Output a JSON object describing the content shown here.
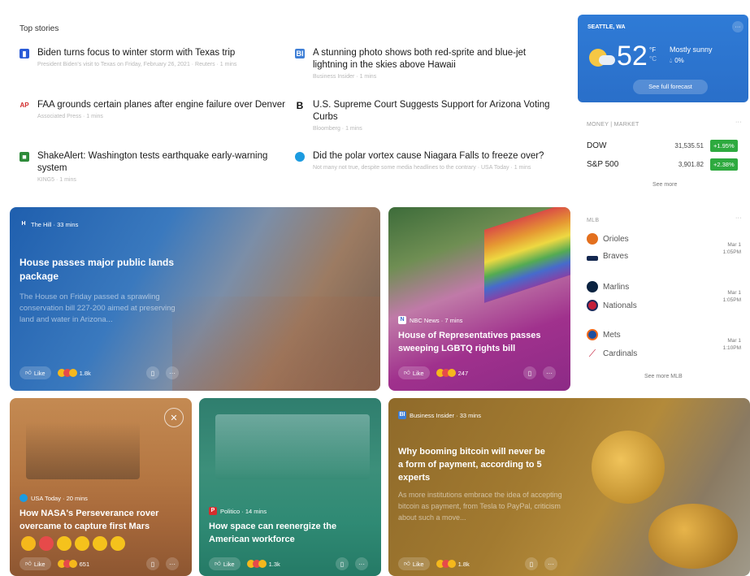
{
  "top_stories": {
    "title": "Top stories",
    "items": [
      {
        "headline": "Biden turns focus to winter storm with Texas trip",
        "meta": "President Biden's visit to Texas on Friday, February 26, 2021 · Reuters · 1 mins",
        "icon": "reuters-icon",
        "color": "#2a5bd7"
      },
      {
        "headline": "A stunning photo shows both red-sprite and blue-jet lightning in the skies above Hawaii",
        "meta": "Business Insider · 1 mins",
        "icon": "business-insider-icon",
        "color": "#3f7fd6"
      },
      {
        "headline": "FAA grounds certain planes after engine failure over Denver",
        "meta": "Associated Press · 1 mins",
        "icon": "ap-icon",
        "color": "#d22d2d"
      },
      {
        "headline": "U.S. Supreme Court Suggests Support for Arizona Voting Curbs",
        "meta": "Bloomberg · 1 mins",
        "icon": "bloomberg-icon",
        "color": "#111111"
      },
      {
        "headline": "ShakeAlert: Washington tests earthquake early-warning system",
        "meta": "KING5 · 1 mins",
        "icon": "king5-icon",
        "color": "#2e8b3a"
      },
      {
        "headline": "Did the polar vortex cause Niagara Falls to freeze over?",
        "meta": "Not many not true, despite some media headlines to the contrary · USA Today · 1 mins",
        "icon": "usa-today-icon",
        "color": "#1c9be0"
      }
    ]
  },
  "cards": [
    {
      "source": "The Hill · 33 mins",
      "logo": "H",
      "title": "House passes major public lands package",
      "desc": "The House on Friday passed a sprawling conservation bill 227-200 aimed at preserving land and water in Arizona...",
      "reactions": "1.8k",
      "like": "Like"
    },
    {
      "source": "NBC News · 7 mins",
      "logo": "N",
      "title": "House of Representatives passes sweeping LGBTQ rights bill",
      "desc": "",
      "reactions": "247",
      "like": "Like"
    },
    {
      "source": "USA Today · 20 mins",
      "logo": "U",
      "title": "How NASA's Perseverance rover overcame to capture first Mars",
      "desc": "",
      "reactions": "651",
      "like": "Like"
    },
    {
      "source": "Politico · 14 mins",
      "logo": "P",
      "title": "How space can reenergize the American workforce",
      "desc": "",
      "reactions": "1.3k",
      "like": "Like"
    },
    {
      "source": "Business Insider · 33 mins",
      "logo": "BI",
      "title": "Why booming bitcoin will never be a form of payment, according to 5 experts",
      "desc": "As more institutions embrace the idea of accepting bitcoin as payment, from Tesla to PayPal, criticism about such a move...",
      "reactions": "1.8k",
      "like": "Like"
    }
  ],
  "weather": {
    "location": "SEATTLE, WA",
    "temp": "52",
    "unit_f": "°F",
    "unit_c": "°C",
    "condition": "Mostly sunny",
    "precip": "0%",
    "forecast_button": "See full forecast",
    "more": "···"
  },
  "market": {
    "title": "MONEY | MARKET",
    "more": "···",
    "rows": [
      {
        "name": "DOW",
        "value": "31,535.51",
        "change": "+1.95%"
      },
      {
        "name": "S&P 500",
        "value": "3,901.82",
        "change": "+2.38%"
      }
    ],
    "see_more": "See more",
    "up_color": "#2eaa3f"
  },
  "mlb": {
    "title": "MLB",
    "more": "···",
    "games": [
      {
        "team1": "Orioles",
        "team2": "Braves",
        "date": "Mar 1",
        "time": "1:05PM"
      },
      {
        "team1": "Marlins",
        "team2": "Nationals",
        "date": "Mar 1",
        "time": "1:05PM"
      },
      {
        "team1": "Mets",
        "team2": "Cardinals",
        "date": "Mar 1",
        "time": "1:10PM"
      }
    ],
    "see_more": "See more MLB"
  }
}
